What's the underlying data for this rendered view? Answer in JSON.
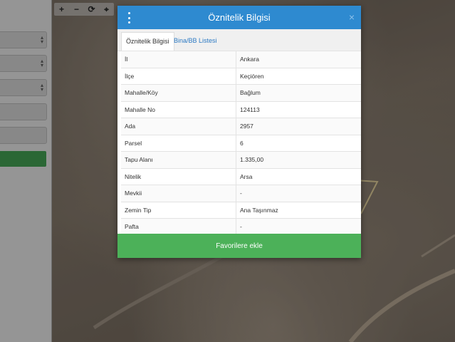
{
  "map": {
    "zoom_in": "+",
    "zoom_out": "−",
    "refresh": "⟳",
    "locate": "⌖"
  },
  "modal": {
    "title": "Öznitelik Bilgisi",
    "close": "×",
    "tabs": [
      {
        "label": "Öznitelik Bilgisi"
      },
      {
        "label": "Bina/BB Listesi"
      }
    ],
    "rows": [
      {
        "label": "İl",
        "value": "Ankara"
      },
      {
        "label": "İlçe",
        "value": "Keçiören"
      },
      {
        "label": "Mahalle/Köy",
        "value": "Bağlum"
      },
      {
        "label": "Mahalle No",
        "value": "124113"
      },
      {
        "label": "Ada",
        "value": "2957"
      },
      {
        "label": "Parsel",
        "value": "6"
      },
      {
        "label": "Tapu Alanı",
        "value": "1.335,00"
      },
      {
        "label": "Nitelik",
        "value": "Arsa"
      },
      {
        "label": "Mevkii",
        "value": "-"
      },
      {
        "label": "Zemin Tip",
        "value": "Ana Taşınmaz"
      },
      {
        "label": "Pafta",
        "value": "-"
      }
    ],
    "favorite_button": "Favorilere ekle"
  },
  "colors": {
    "header": "#2e8ad0",
    "favorite": "#4cb159",
    "tab_link": "#2e7bc4"
  }
}
